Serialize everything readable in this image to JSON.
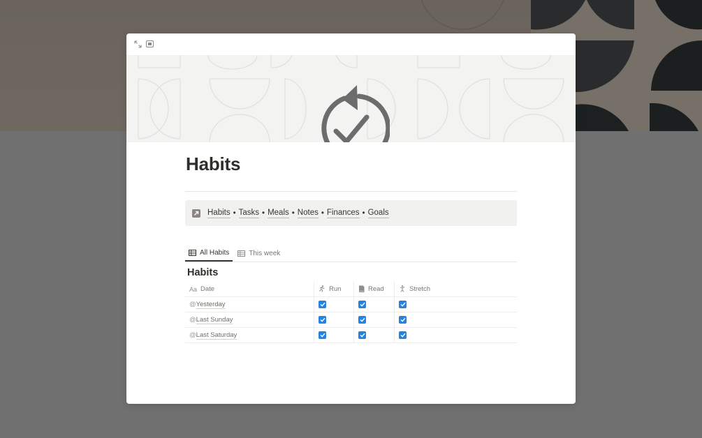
{
  "page": {
    "title": "Habits",
    "cover_icon": "circular-arrow-check-icon"
  },
  "toolbar": {
    "expand_icon": "expand-arrows-icon",
    "peek_icon": "peek-mode-icon"
  },
  "callout": {
    "icon": "arrow-up-right-icon",
    "links": [
      "Habits",
      "Tasks",
      "Meals",
      "Notes",
      "Finances",
      "Goals"
    ],
    "separator": "•"
  },
  "tabs": [
    {
      "label": "All Habits",
      "icon": "table-icon",
      "active": true
    },
    {
      "label": "This week",
      "icon": "table-icon",
      "active": false
    }
  ],
  "database": {
    "title": "Habits",
    "columns": [
      {
        "label": "Date",
        "icon": "text-aa-icon"
      },
      {
        "label": "Run",
        "icon": "running-person-icon"
      },
      {
        "label": "Read",
        "icon": "book-icon"
      },
      {
        "label": "Stretch",
        "icon": "stretching-person-icon"
      }
    ],
    "rows": [
      {
        "date": "Yesterday",
        "run": true,
        "read": true,
        "stretch": true
      },
      {
        "date": "Last Sunday",
        "run": true,
        "read": true,
        "stretch": true
      },
      {
        "date": "Last Saturday",
        "run": true,
        "read": true,
        "stretch": true
      }
    ],
    "at_prefix": "@",
    "date_header_prefix": "Aa"
  },
  "colors": {
    "accent_checkbox": "#2383e2",
    "title_text": "#2f2e2a",
    "callout_bg": "#f1f1ef"
  }
}
